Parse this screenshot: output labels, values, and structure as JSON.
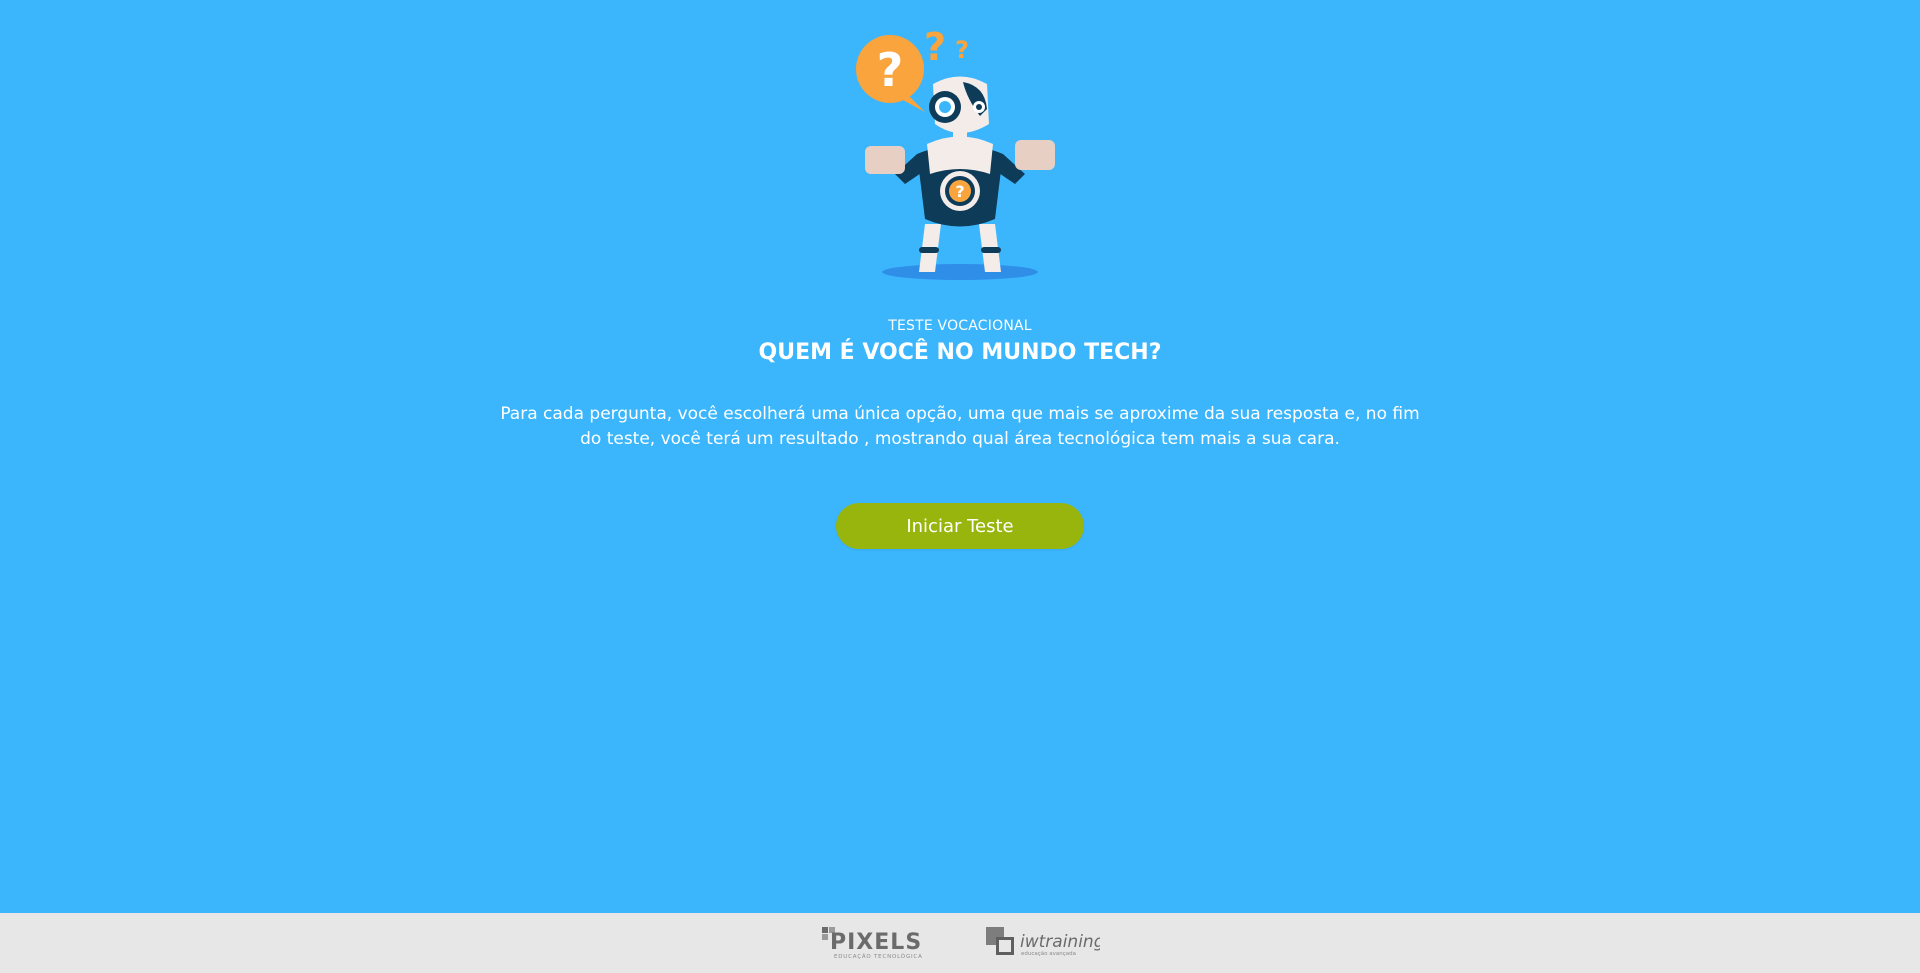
{
  "hero": {
    "eyebrow": "TESTE VOCACIONAL",
    "title": "QUEM É VOCÊ NO MUNDO TECH?",
    "description": "Para cada pergunta, você escolherá uma única opção, uma que mais se aproxime da sua resposta e, no fim do teste, você terá um resultado , mostrando qual área tecnológica tem mais a sua cara.",
    "illustration_icon": "confused-robot-illustration"
  },
  "actions": {
    "start_label": "Iniciar Teste"
  },
  "footer": {
    "logos": [
      {
        "name": "PIXELS",
        "tagline": "EDUCAÇÃO TECNOLÓGICA",
        "icon": "pixels-logo"
      },
      {
        "name": "iwtraining",
        "tagline": "educação avançada",
        "icon": "iwtraining-logo"
      }
    ]
  },
  "colors": {
    "background": "#3bb6fd",
    "button": "#98b50e",
    "footer": "#e7e7e7",
    "accent": "#f9a43c",
    "robot_dark": "#0d3b58"
  }
}
